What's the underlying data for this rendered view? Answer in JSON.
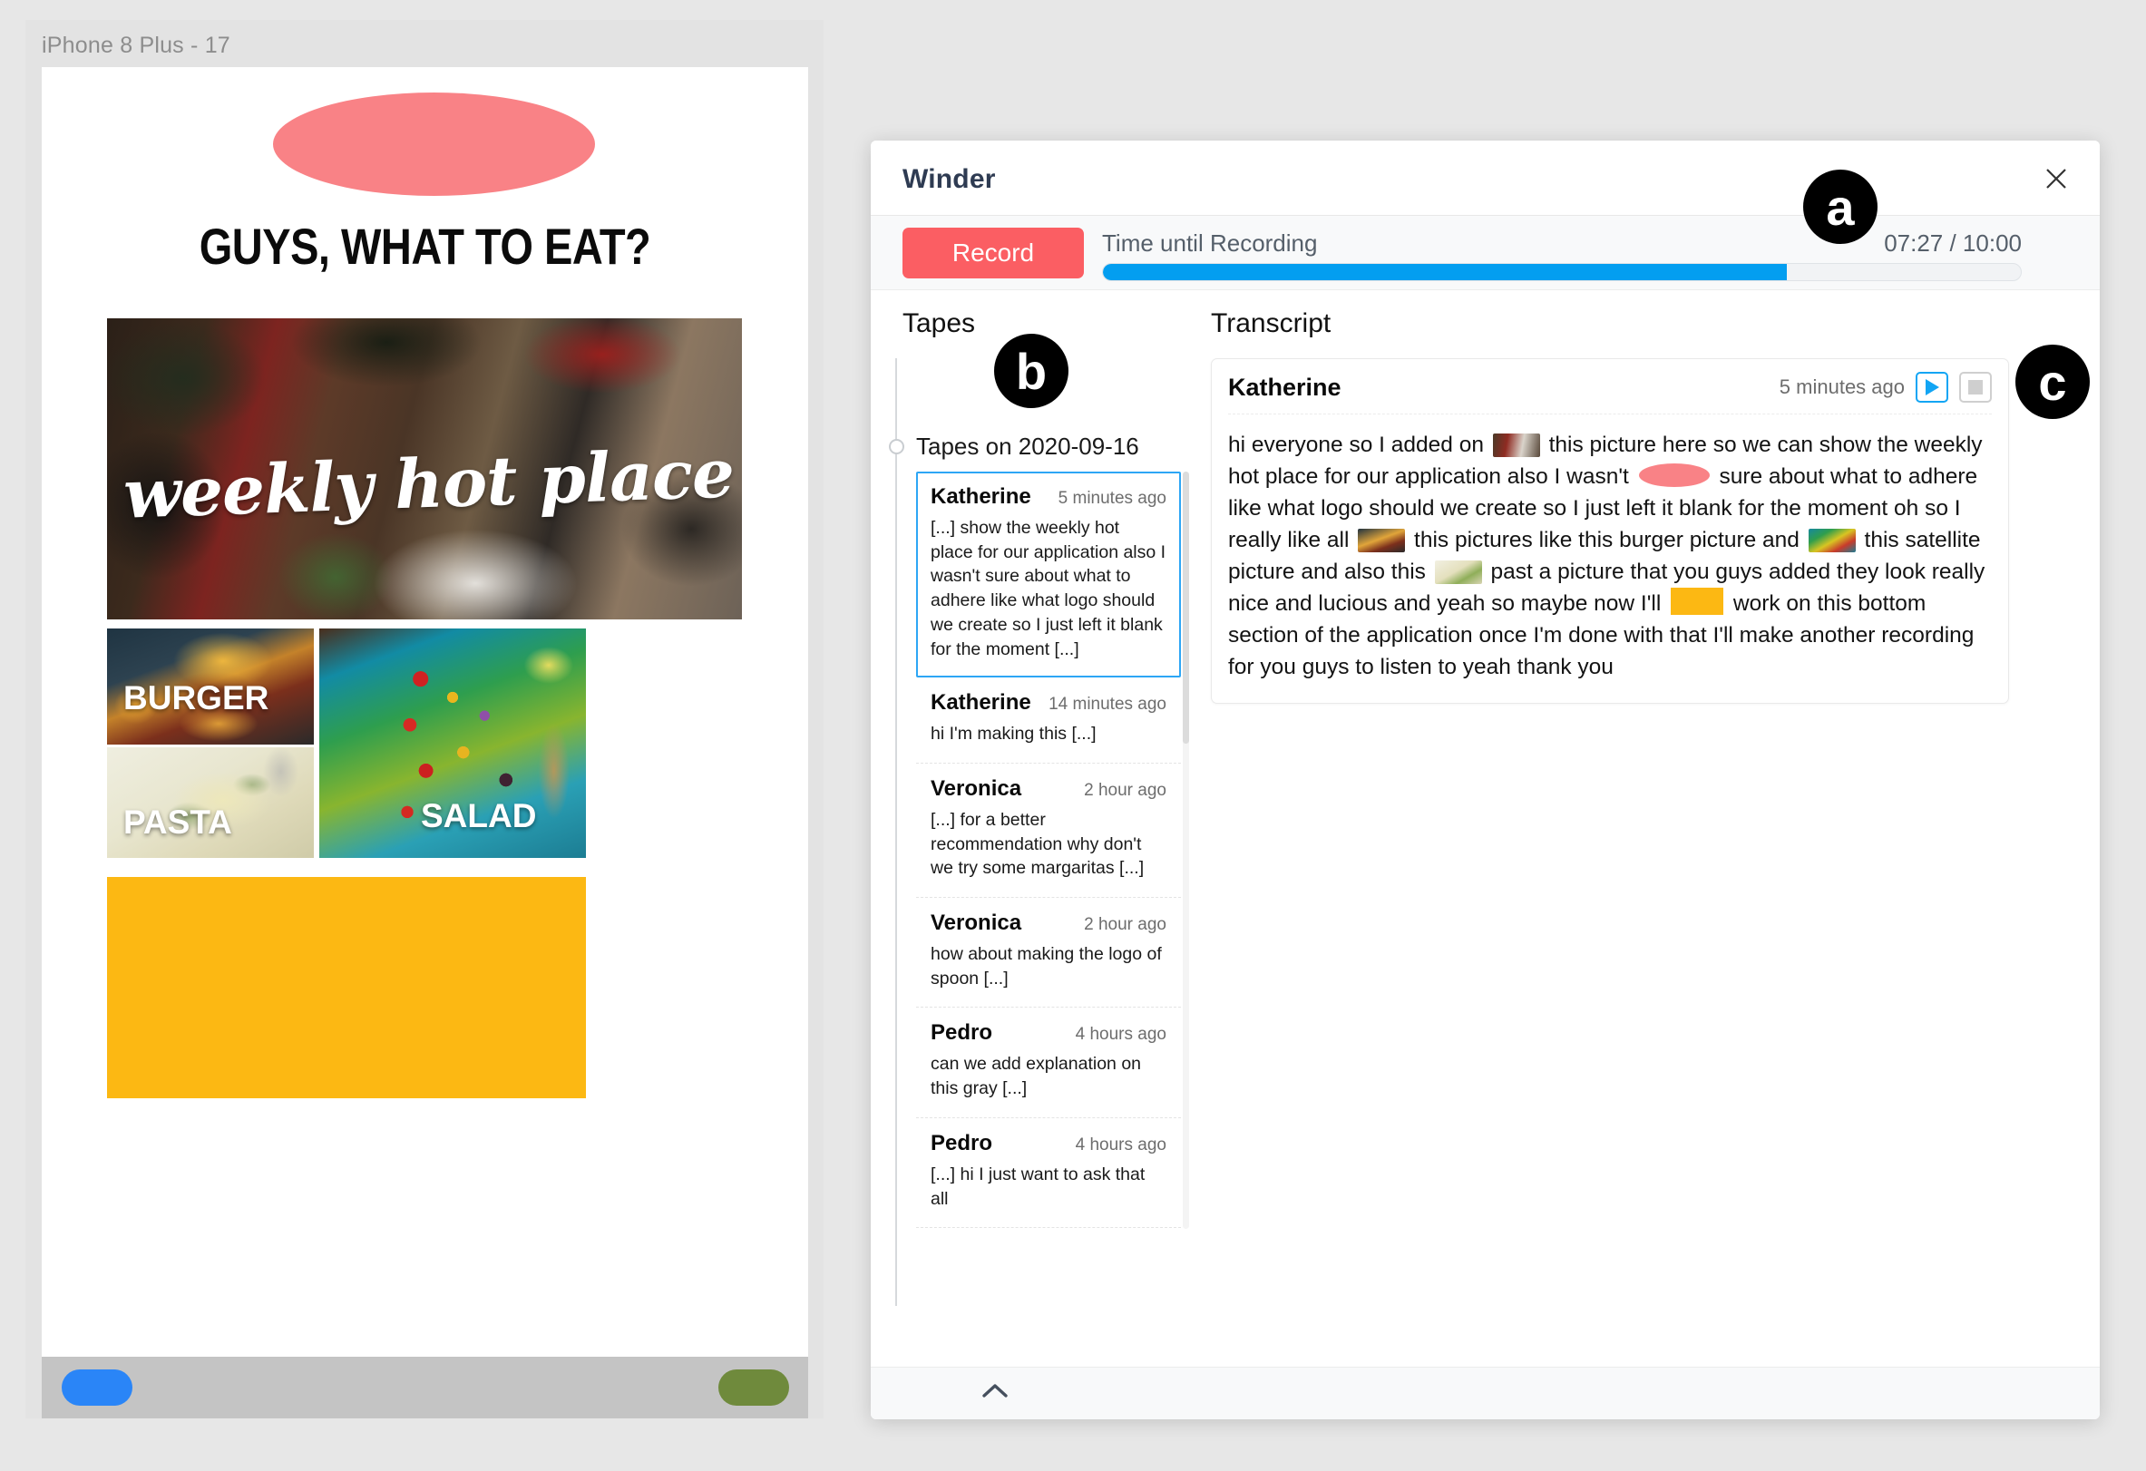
{
  "simulator": {
    "title": "iPhone 8 Plus - 17",
    "app": {
      "headline": "GUYS, WHAT TO EAT?",
      "hero_caption": "weekly hot place",
      "tiles": [
        {
          "label": "BURGER"
        },
        {
          "label": "PASTA"
        },
        {
          "label": "SALAD"
        }
      ]
    }
  },
  "winder": {
    "title": "Winder",
    "close_icon": "close-icon",
    "record": {
      "button_label": "Record",
      "time_label": "Time until Recording",
      "time_value": "07:27 / 10:00",
      "progress_percent": 74.5,
      "accent_color": "#fb5e63",
      "progress_color": "#039ef0"
    },
    "tapes": {
      "heading": "Tapes",
      "date_group": "Tapes on 2020-09-16",
      "items": [
        {
          "name": "Katherine",
          "time": "5 minutes ago",
          "snippet": "[...] show the weekly hot place for our application also I wasn't sure about what to adhere like what logo should we create so I just left it blank for the moment [...]",
          "selected": true
        },
        {
          "name": "Katherine",
          "time": "14 minutes ago",
          "snippet": "hi I'm making this [...]",
          "selected": false
        },
        {
          "name": "Veronica",
          "time": "2 hour ago",
          "snippet": "[...] for a better recommendation why don't we try some margaritas [...]",
          "selected": false
        },
        {
          "name": "Veronica",
          "time": "2 hour ago",
          "snippet": "how about making the logo of spoon [...]",
          "selected": false
        },
        {
          "name": "Pedro",
          "time": "4 hours ago",
          "snippet": "can we add explanation on this gray [...]",
          "selected": false
        },
        {
          "name": "Pedro",
          "time": "4 hours ago",
          "snippet": "[...] hi I just want to ask that all",
          "selected": false
        }
      ]
    },
    "transcript": {
      "heading": "Transcript",
      "card": {
        "name": "Katherine",
        "time": "5 minutes ago",
        "play_icon": "play-icon",
        "stop_icon": "stop-icon",
        "segments": [
          {
            "type": "text",
            "value": "hi everyone so I added on "
          },
          {
            "type": "thumb",
            "value": "hero-photo-thumbnail"
          },
          {
            "type": "text",
            "value": " this picture here so we can show the weekly hot place for our application also I wasn't "
          },
          {
            "type": "blob",
            "value": "pink-ellipse-logo"
          },
          {
            "type": "text",
            "value": " sure about what to adhere like what logo should we create so I just left it blank for the moment oh so I really like all "
          },
          {
            "type": "thumb",
            "value": "burger-photo-thumbnail"
          },
          {
            "type": "text",
            "value": " this pictures like this burger picture and "
          },
          {
            "type": "thumb",
            "value": "salad-photo-thumbnail"
          },
          {
            "type": "text",
            "value": " this satellite picture and also this "
          },
          {
            "type": "thumb",
            "value": "pasta-photo-thumbnail"
          },
          {
            "type": "text",
            "value": " past a picture that you guys added they look really nice and lucious and yeah so maybe now I'll "
          },
          {
            "type": "blob",
            "value": "yellow-block"
          },
          {
            "type": "text",
            "value": " work on this bottom section of the application once I'm done with that I'll make another recording for you guys to listen to yeah thank you"
          }
        ]
      }
    },
    "footer": {
      "collapse_icon": "chevron-up-icon"
    }
  },
  "annotations": [
    {
      "label": "a"
    },
    {
      "label": "b"
    },
    {
      "label": "c"
    }
  ]
}
